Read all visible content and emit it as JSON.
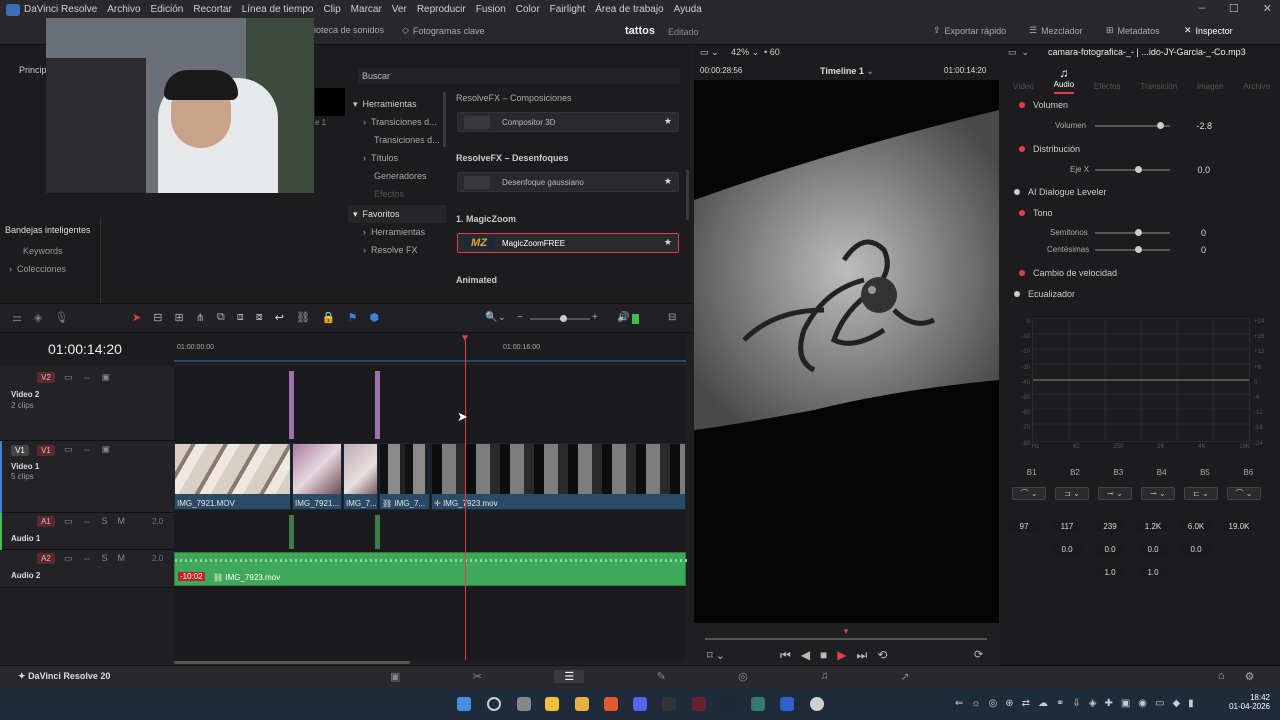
{
  "menu": {
    "app": "DaVinci Resolve",
    "items": [
      "Archivo",
      "Edición",
      "Recortar",
      "Línea de tiempo",
      "Clip",
      "Marcar",
      "Ver",
      "Reproducir",
      "Fusion",
      "Color",
      "Fairlight",
      "Área de trabajo",
      "Ayuda"
    ]
  },
  "toolbar": {
    "sound_library": "ioteca de sonidos",
    "keyframes": "Fotogramas clave",
    "project": "tattos",
    "project_status": "Editado",
    "quick_export": "Exportar rápido",
    "mixer": "Mezclador",
    "metadata": "Metadatos",
    "inspector": "Inspector"
  },
  "left": {
    "princip": "Princip",
    "smart_bins": "Bandejas inteligentes",
    "keywords": "Keywords",
    "collections": "Colecciones",
    "clip_hint": "e 1"
  },
  "effects": {
    "search": "Buscar",
    "tree": [
      "Herramientas",
      "Transiciones d...",
      "Transiciones d...",
      "Títulos",
      "Generadores",
      "Efectos"
    ],
    "favorites": "Favoritos",
    "fav_items": [
      "Herramientas",
      "Resolve FX"
    ],
    "sec1": "ResolveFX – Composiciones",
    "item1": "Compositor 3D",
    "sec2": "ResolveFX – Desenfoques",
    "item2": "Desenfoque gaussiano",
    "sec3": "1. MagicZoom",
    "item3": "MagicZoomFREE",
    "item3_logo": "MZ",
    "sec4": "Animated"
  },
  "viewer": {
    "zoom": "42%",
    "fps": "60",
    "source_tc": "00:00:28:56",
    "timeline": "Timeline 1",
    "record_tc": "01:00:14:20"
  },
  "inspector": {
    "filename": "camara-fotografica-_- | ...ido-JY-Garcia-_-Co.mp3",
    "tabs": [
      "Vídeo",
      "Audio",
      "Efectos",
      "Transición",
      "Imagen",
      "Archivo"
    ],
    "active_tab": "Audio",
    "volumen": "Volumen",
    "volumen_label": "Volumen",
    "volumen_val": "-2.8",
    "distribucion": "Distribución",
    "eje_x": "Eje X",
    "eje_x_val": "0.0",
    "ai_leveler": "AI Dialogue Leveler",
    "tono": "Tono",
    "semitonos": "Semitonos",
    "semitonos_val": "0",
    "centesimas": "Centésimas",
    "centesimas_val": "0",
    "velocidad": "Cambio de velocidad",
    "ecualizador": "Ecualizador",
    "eq_bands": [
      "B1",
      "B2",
      "B3",
      "B4",
      "B5",
      "B6"
    ],
    "eq_freq": [
      "97",
      "117",
      "239",
      "1.2K",
      "6.0K",
      "19.0K"
    ],
    "eq_gain": [
      "0.0",
      "0.0",
      "0.0",
      "0.0"
    ],
    "eq_q": [
      "1.0",
      "1.0"
    ],
    "eq_y_right": [
      "+24",
      "+18",
      "+12",
      "+6",
      "0",
      "-6",
      "-12",
      "-18",
      "-24"
    ],
    "eq_y_left": [
      "0",
      "-10",
      "-20",
      "-30",
      "-40",
      "-50",
      "-60",
      "-70",
      "-80"
    ],
    "eq_x": [
      "Hz",
      "62",
      "250",
      "1K",
      "4K",
      "16K"
    ]
  },
  "timeline": {
    "timecode": "01:00:14:20",
    "ruler": [
      "01:00:00:00",
      "01:00:16:00"
    ],
    "tracks": [
      {
        "id": "V2",
        "name": "Video 2",
        "count": "2 clips"
      },
      {
        "id": "V1",
        "name": "Video 1",
        "count": "5 clips"
      },
      {
        "id": "A1",
        "name": "Audio 1",
        "level": "2.0"
      },
      {
        "id": "A2",
        "name": "Audio 2",
        "level": "2.0"
      }
    ],
    "clips": [
      "IMG_7921.MOV",
      "IMG_7921...",
      "IMG_7...",
      "IMG_7...",
      "IMG_7923.mov"
    ],
    "audio_clip": "IMG_7923.mov",
    "audio_gain": "-10:02"
  },
  "pagebar": {
    "brand": "DaVinci Resolve 20"
  },
  "taskbar": {
    "time": "18:42",
    "date": "01-04-2026"
  }
}
